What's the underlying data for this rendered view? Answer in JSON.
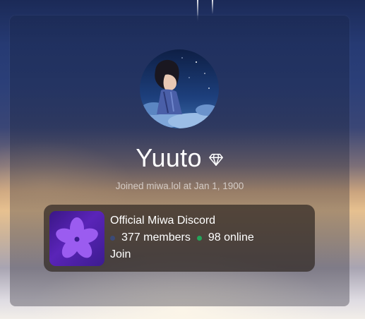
{
  "profile": {
    "username": "Yuuto",
    "badge_icon": "diamond-icon",
    "joined_text": "Joined miwa.lol at Jan 1, 1900"
  },
  "invite": {
    "server_name": "Official Miwa Discord",
    "server_icon": "flower-icon",
    "members_text": "377 members",
    "online_text": "98 online",
    "join_label": "Join",
    "colors": {
      "online": "#23a55a",
      "offline": "#3b4a78",
      "icon_bg": "#5a24b8",
      "petal": "#9b5cf0"
    }
  }
}
